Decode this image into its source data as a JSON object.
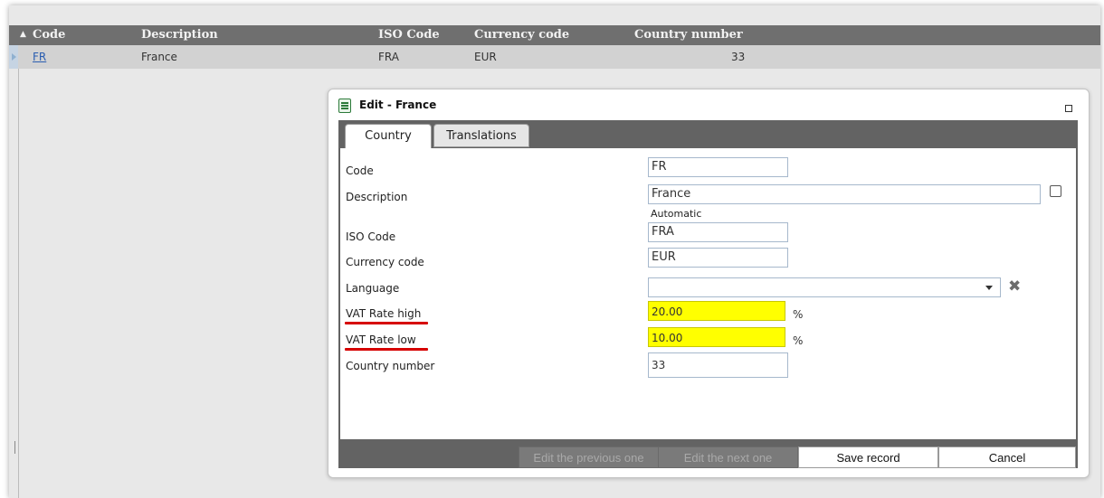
{
  "grid": {
    "headers": [
      "Code",
      "Description",
      "ISO Code",
      "Currency code",
      "Country number"
    ],
    "row": {
      "code": "FR",
      "description": "France",
      "iso_code": "FRA",
      "currency_code": "EUR",
      "country_number": "33"
    }
  },
  "dialog": {
    "title": "Edit - France",
    "tabs": [
      "Country",
      "Translations"
    ],
    "fields": {
      "code": {
        "label": "Code",
        "value": "FR"
      },
      "description": {
        "label": "Description",
        "value": "France",
        "note": "Automatic"
      },
      "iso_code": {
        "label": "ISO Code",
        "value": "FRA"
      },
      "currency_code": {
        "label": "Currency code",
        "value": "EUR"
      },
      "language": {
        "label": "Language",
        "value": ""
      },
      "vat_high": {
        "label": "VAT Rate high",
        "value": "20.00",
        "unit": "%"
      },
      "vat_low": {
        "label": "VAT Rate low",
        "value": "10.00",
        "unit": "%"
      },
      "country_number": {
        "label": "Country number",
        "value": "33"
      }
    },
    "buttons": {
      "previous": "Edit the previous one",
      "next": "Edit the next one",
      "save": "Save record",
      "cancel": "Cancel"
    },
    "highlight_color": "#ffff00",
    "annotation_color": "#d60000"
  }
}
